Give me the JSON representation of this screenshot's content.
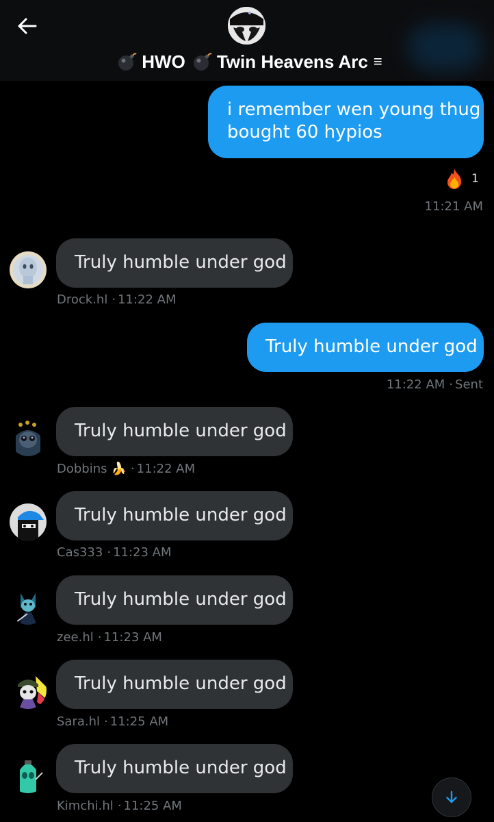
{
  "header": {
    "title_part1": "HWO",
    "title_part2": "Twin Heavens Arc",
    "menu_glyph": "≡",
    "icons": {
      "back": "arrow-left-icon",
      "bomb": "bomb-icon",
      "menu": "menu-icon"
    }
  },
  "messages": [
    {
      "direction": "out",
      "line1": "i remember wen young thug",
      "line2": "bought 60 hypios",
      "reaction": {
        "emoji": "fire",
        "count": "1"
      },
      "time": "11:21 AM"
    },
    {
      "direction": "in",
      "text": "Truly humble under god",
      "sender": "Drock.hl",
      "time": "11:22 AM"
    },
    {
      "direction": "out",
      "text": "Truly humble under god",
      "time": "11:22 AM",
      "status": "Sent"
    },
    {
      "direction": "in",
      "text": "Truly humble under god",
      "sender": "Dobbins",
      "sender_badge": "🍌",
      "time": "11:22 AM"
    },
    {
      "direction": "in",
      "text": "Truly humble under god",
      "sender": "Cas333",
      "time": "11:23 AM"
    },
    {
      "direction": "in",
      "text": "Truly humble under god",
      "sender": "zee.hl",
      "time": "11:23 AM"
    },
    {
      "direction": "in",
      "text": "Truly humble under god",
      "sender": "Sara.hl",
      "time": "11:25 AM"
    },
    {
      "direction": "in",
      "text": "Truly humble under god",
      "sender": "Kimchi.hl",
      "time": "11:25 AM"
    }
  ],
  "colors": {
    "outgoing_bubble": "#1d9bf0",
    "incoming_bubble": "#2f3336",
    "meta_text": "#71767b",
    "background": "#000000"
  },
  "scroll_button": {
    "icon": "arrow-down-icon"
  }
}
